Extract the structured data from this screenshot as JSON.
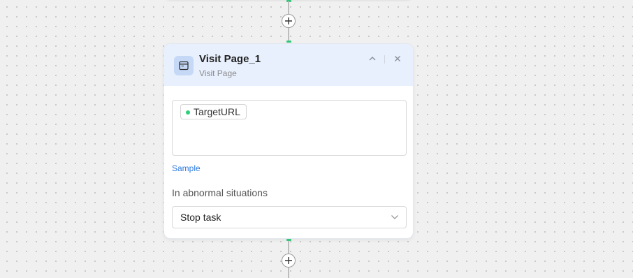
{
  "canvas": {
    "port_color": "#34c77b"
  },
  "previous_node": {},
  "node": {
    "title": "Visit Page_1",
    "subtitle": "Visit Page",
    "icon": "browser-window-icon",
    "header_bg": "#e8f0fd",
    "url_variable": "TargetURL",
    "url_variable_dot_color": "#2fcf7a",
    "sample_link": "Sample",
    "abnormal_label": "In abnormal situations",
    "abnormal_select_value": "Stop task",
    "controls": [
      "collapse-icon",
      "close-icon"
    ]
  },
  "add_buttons": [
    {
      "icon": "plus-icon"
    },
    {
      "icon": "plus-icon"
    }
  ]
}
